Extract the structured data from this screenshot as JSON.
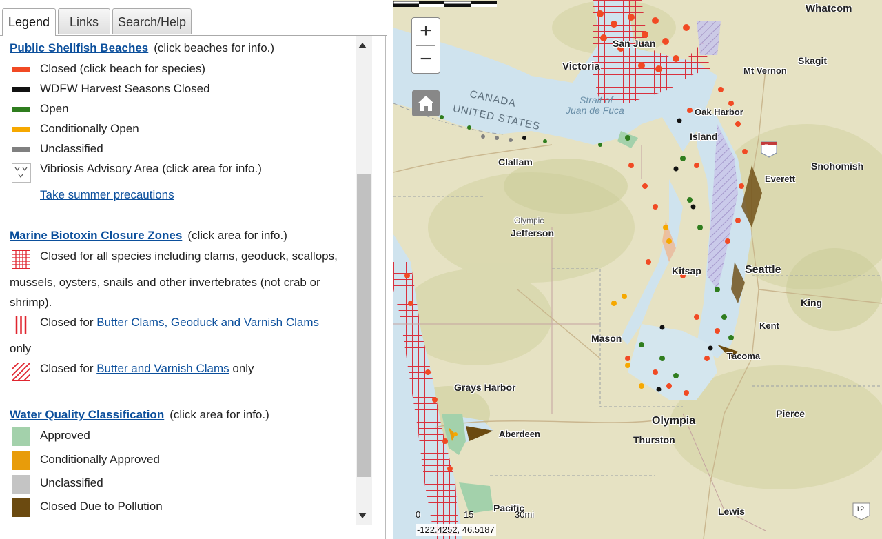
{
  "tabs": [
    {
      "label": "Legend"
    },
    {
      "label": "Links"
    },
    {
      "label": "Search/Help"
    }
  ],
  "legend": {
    "shellfish": {
      "title": "Public Shellfish Beaches",
      "note": "(click beaches for info.)",
      "items": [
        {
          "label": "Closed (click beach for species)",
          "color": "#f14a24"
        },
        {
          "label": "WDFW Harvest Seasons Closed",
          "color": "#111111"
        },
        {
          "label": "Open",
          "color": "#2f7d1e"
        },
        {
          "label": "Conditionally Open",
          "color": "#f6a800"
        },
        {
          "label": "Unclassified",
          "color": "#808080"
        }
      ],
      "vibriosis_label": "Vibriosis Advisory Area (click area for info.)",
      "vibriosis_link": "Take summer precautions"
    },
    "biotoxin": {
      "title": "Marine Biotoxin Closure Zones",
      "note": "(click area for info.)",
      "item1_line1": "Closed for all species including clams, geoduck, scallops,",
      "item1_line2": "mussels, oysters, snails and other invertebrates (not crab or",
      "item1_line3": "shrimp).",
      "item2_prefix": "Closed for ",
      "item2_link": "Butter Clams, Geoduck and Varnish Clams",
      "item2_suffix": "only",
      "item3_prefix": "Closed for ",
      "item3_link": "Butter and Varnish Clams",
      "item3_suffix": " only"
    },
    "water_quality": {
      "title": "Water Quality Classification",
      "note": "(click area for info.)",
      "items": [
        {
          "label": "Approved",
          "color": "#a3d1ab"
        },
        {
          "label": "Conditionally Approved",
          "color": "#e89c0a"
        },
        {
          "label": "Unclassified",
          "color": "#c4c4c4"
        },
        {
          "label": "Closed Due to Pollution",
          "color": "#6b4a10"
        }
      ]
    }
  },
  "map": {
    "zoom_in": "+",
    "zoom_out": "−",
    "labels": {
      "whatcom": "Whatcom",
      "san_juan": "San Juan",
      "victoria": "Victoria",
      "mt_vernon": "Mt Vernon",
      "skagit": "Skagit",
      "canada": "CANADA",
      "united_states": "UNITED STATES",
      "strait": "Strait of",
      "juan_de_fuca": "Juan de Fuca",
      "oak_harbor": "Oak Harbor",
      "island": "Island",
      "everett": "Everett",
      "snohomish": "Snohomish",
      "clallam": "Clallam",
      "olympic": "Olympic",
      "jefferson": "Jefferson",
      "kitsap": "Kitsap",
      "seattle": "Seattle",
      "king": "King",
      "kent": "Kent",
      "mason": "Mason",
      "tacoma": "Tacoma",
      "grays_harbor": "Grays Harbor",
      "olympia": "Olympia",
      "thurston": "Thurston",
      "pierce": "Pierce",
      "aberdeen": "Aberdeen",
      "pacific": "Pacific",
      "lewis": "Lewis",
      "highway_5": "5",
      "highway_12": "12"
    },
    "scale": {
      "zero": "0",
      "mid": "15",
      "end": "30mi"
    },
    "coordinates": "-122.4252, 46.5187"
  }
}
